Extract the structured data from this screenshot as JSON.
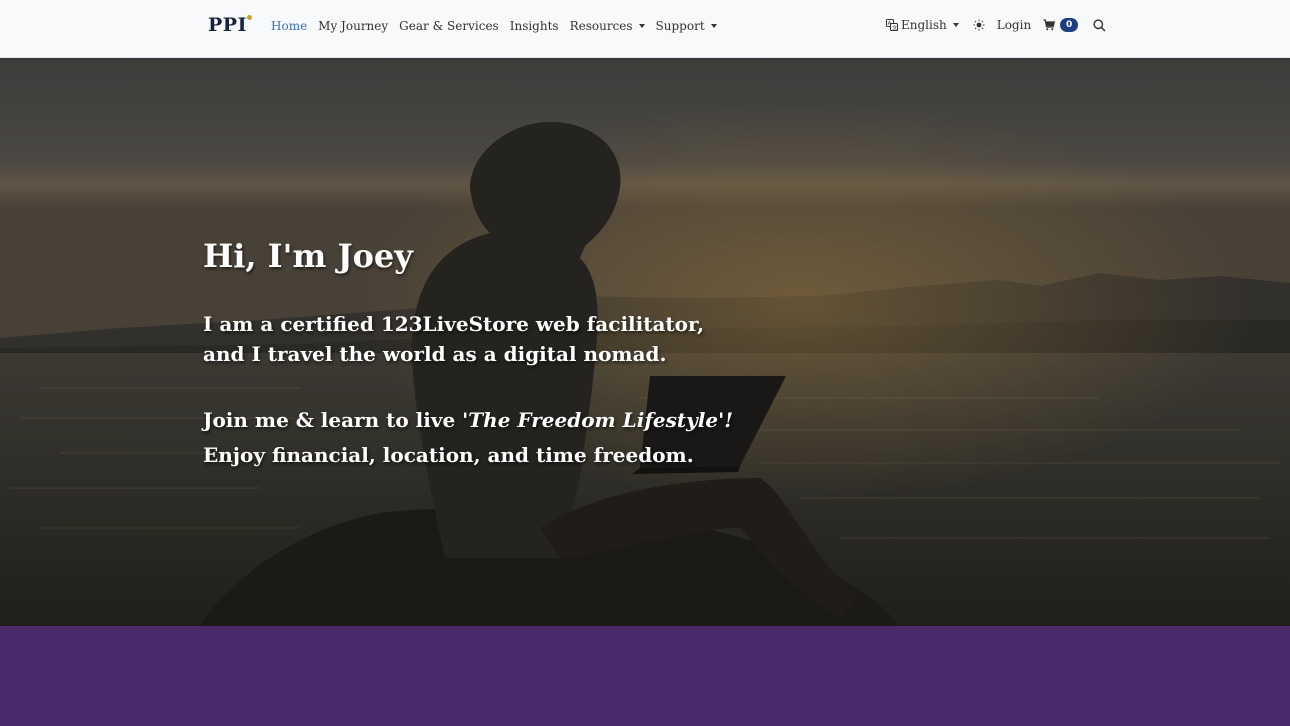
{
  "brand": {
    "logo_text": "PPI"
  },
  "nav": {
    "items": [
      {
        "label": "Home",
        "active": true,
        "dropdown": false
      },
      {
        "label": "My Journey",
        "active": false,
        "dropdown": false
      },
      {
        "label": "Gear & Services",
        "active": false,
        "dropdown": false
      },
      {
        "label": "Insights",
        "active": false,
        "dropdown": false
      },
      {
        "label": "Resources",
        "active": false,
        "dropdown": true
      },
      {
        "label": "Support",
        "active": false,
        "dropdown": true
      }
    ]
  },
  "nav_right": {
    "language_label": "English",
    "language_icon": "translate-icon",
    "theme_icon": "sun-icon",
    "login_label": "Login",
    "cart_icon": "cart-icon",
    "cart_count": "0",
    "search_icon": "search-icon"
  },
  "hero": {
    "title": "Hi, I'm Joey",
    "line1": "I am a certified 123LiveStore web facilitator,",
    "line2": "and I travel the world as a digital nomad.",
    "line3_prefix": "Join me & learn to live ",
    "line3_emphasis": "'The Freedom Lifestyle'!",
    "line4": "Enjoy financial, location, and time freedom."
  },
  "colors": {
    "accent": "#3a6fb8",
    "brand_dark": "#14233f",
    "badge": "#1d3e80",
    "band_purple": "#4a2a6a"
  }
}
